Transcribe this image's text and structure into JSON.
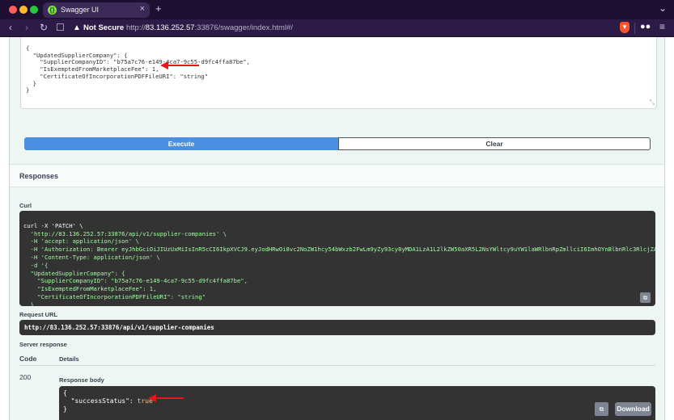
{
  "browser": {
    "tab_title": "Swagger UI",
    "tab_close": "×",
    "new_tab": "+",
    "tabs_menu": "⌄",
    "security_label": "Not Secure",
    "url_scheme": "http://",
    "url_host": "83.136.252.57",
    "url_rest": ":33876/swagger/index.html#/"
  },
  "request_body": {
    "text": "{\n  \"UpdatedSupplierCompany\": {\n    \"SupplierCompanyID\": \"b75a7c76-e149-4ca7-9c55-d9fc4ffa87be\",\n    \"IsExemptedFromMarketplaceFee\": 1,\n    \"CertificateOfIncorporationPDFFileURI\": \"string\"\n  }\n}"
  },
  "buttons": {
    "execute": "Execute",
    "clear": "Clear",
    "download": "Download"
  },
  "responses": {
    "title": "Responses",
    "curl_label": "Curl",
    "curl_lines": [
      "curl -X 'PATCH' \\",
      "  'http://83.136.252.57:33876/api/v1/supplier-companies' \\",
      "  -H 'accept: application/json' \\",
      "  -H 'Authorization: Bearer eyJhbGciOiJIUzUxMiIsInR5cCI6IkpXVCJ9.eyJodHRwOi8vc2NoZW1hcy54bWxzb2FwLm9yZy93cy8yMDA1LzA1L2lkZW50aXR5L2NsYWltcy9uYW1laWRlbnRpZmllciI6ImhOYnBlbnRlc3RlcjZAcGVudGVzdGVyLmNvbSJ9' \\",
      "  -H 'Content-Type: application/json' \\",
      "  -d '{",
      "  \"UpdatedSupplierCompany\": {",
      "    \"SupplierCompanyID\": \"b75a7c76-e149-4ca7-9c55-d9fc4ffa87be\",",
      "    \"IsExemptedFromMarketplaceFee\": 1,",
      "    \"CertificateOfIncorporationPDFFileURI\": \"string\"",
      "  }",
      "}'"
    ],
    "request_url_label": "Request URL",
    "request_url": "http://83.136.252.57:33876/api/v1/supplier-companies",
    "server_response_label": "Server response",
    "code_header": "Code",
    "details_header": "Details",
    "status_code": "200",
    "response_body_label": "Response body",
    "response_body": {
      "open": "{",
      "key": "\"successStatus\": ",
      "value": "true",
      "close": "}"
    }
  },
  "colors": {
    "execute": "#4990e2",
    "annotation_arrow": "#e8141b",
    "code_background": "#333333"
  }
}
